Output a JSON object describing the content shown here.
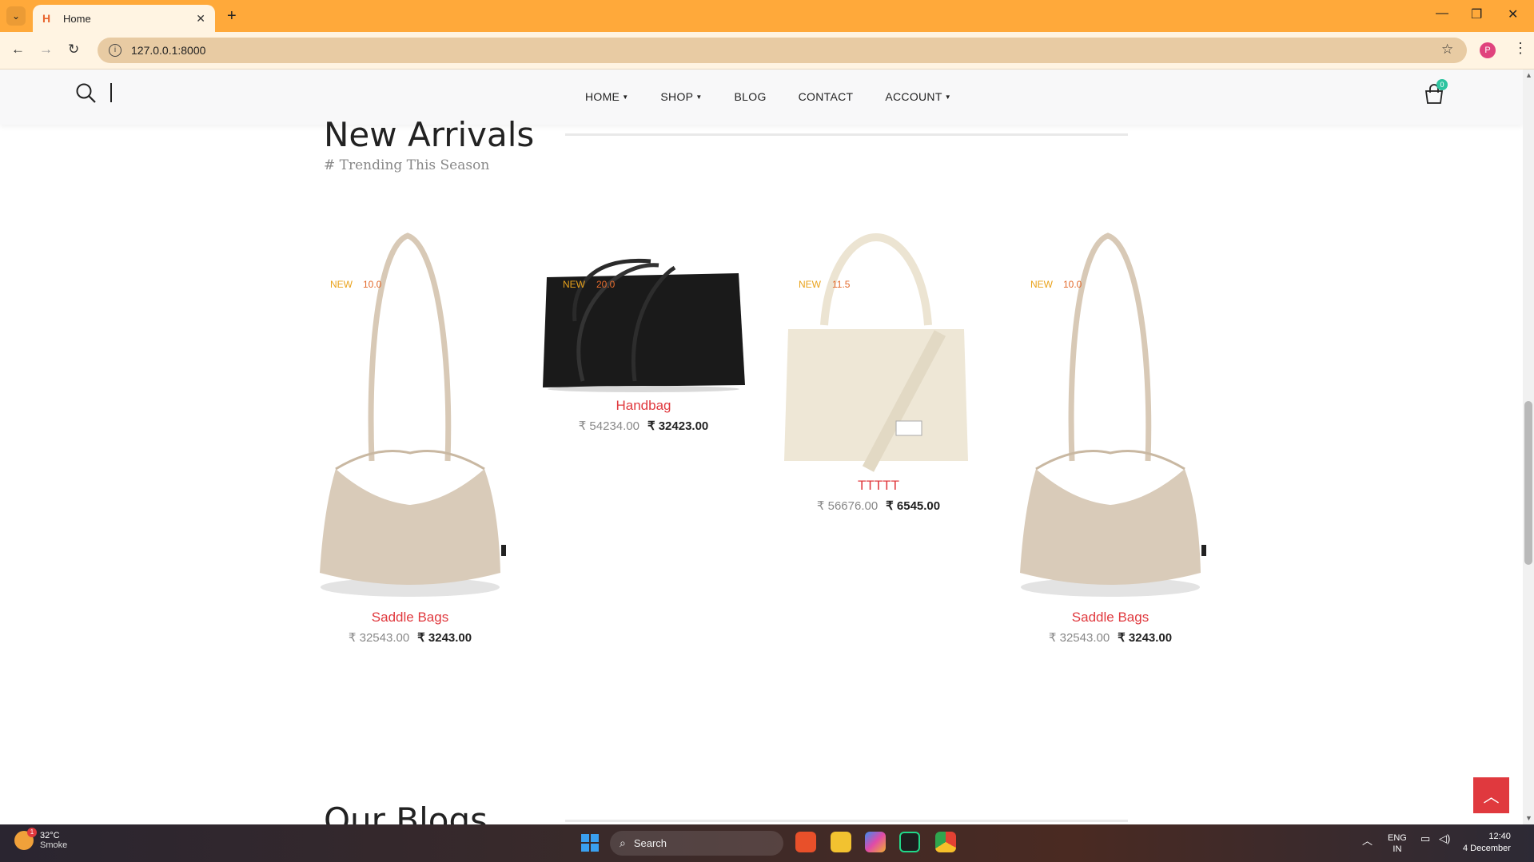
{
  "browser": {
    "tab_title": "Home",
    "url": "127.0.0.1:8000",
    "profile_initial": "P"
  },
  "nav": {
    "items": [
      {
        "label": "HOME",
        "has_dropdown": true
      },
      {
        "label": "SHOP",
        "has_dropdown": true
      },
      {
        "label": "BLOG",
        "has_dropdown": false
      },
      {
        "label": "CONTACT",
        "has_dropdown": false
      },
      {
        "label": "ACCOUNT",
        "has_dropdown": true
      }
    ],
    "cart_count": "0"
  },
  "section": {
    "title": "New Arrivals",
    "subtitle": "# Trending This Season"
  },
  "products": [
    {
      "name": "Saddle Bags",
      "badge": "NEW",
      "badge_value": "10.0",
      "old_price": "₹ 32543.00",
      "price": "₹ 3243.00",
      "image": "beige-corduroy-tote"
    },
    {
      "name": "Handbag",
      "badge": "NEW",
      "badge_value": "20.0",
      "old_price": "₹ 54234.00",
      "price": "₹ 32423.00",
      "image": "black-leather-tote"
    },
    {
      "name": "TTTTT",
      "badge": "NEW",
      "badge_value": "11.5",
      "old_price": "₹ 56676.00",
      "price": "₹ 6545.00",
      "image": "cream-canvas-crossbody"
    },
    {
      "name": "Saddle Bags",
      "badge": "NEW",
      "badge_value": "10.0",
      "old_price": "₹ 32543.00",
      "price": "₹ 3243.00",
      "image": "beige-corduroy-tote"
    }
  ],
  "blogs": {
    "title": "Our Blogs"
  },
  "taskbar": {
    "weather_temp": "32°C",
    "weather_desc": "Smoke",
    "weather_alert": "1",
    "search_placeholder": "Search",
    "lang_top": "ENG",
    "lang_bottom": "IN",
    "time": "12:40",
    "date": "4 December"
  },
  "colors": {
    "accent": "#e0393e",
    "badge_new": "#e9a21a",
    "tabbar": "#ffa93a"
  }
}
